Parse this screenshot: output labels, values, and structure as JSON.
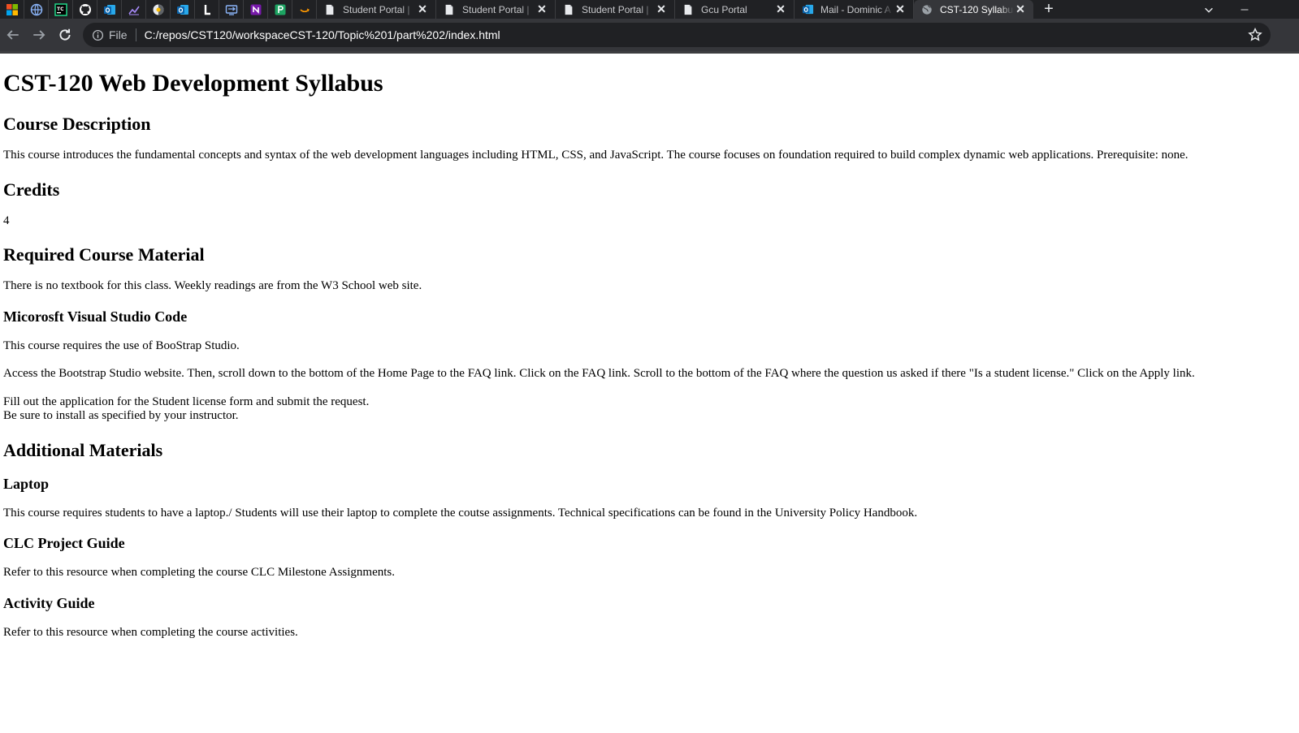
{
  "browser": {
    "tabs": [
      {
        "title": "Student Portal |",
        "icon": "document-icon"
      },
      {
        "title": "Student Portal |",
        "icon": "document-icon"
      },
      {
        "title": "Student Portal |",
        "icon": "document-icon"
      },
      {
        "title": "Gcu Portal",
        "icon": "document-icon"
      },
      {
        "title": "Mail - Dominic A",
        "icon": "outlook-icon"
      },
      {
        "title": "CST-120 Syllabu",
        "icon": "globe-icon"
      }
    ],
    "new_tab_label": "+",
    "close_glyph": "✕",
    "omnibox": {
      "scheme_label": "File",
      "url": "C:/repos/CST120/workspaceCST-120/Topic%201/part%202/index.html"
    },
    "colors": {
      "chrome_dark": "#202124",
      "chrome_mid": "#35363a",
      "tab_text": "#c8c9cc"
    }
  },
  "page": {
    "title": "CST-120 Web Development Syllabus",
    "course_description": {
      "heading": "Course Description",
      "text": "This course introduces the fundamental concepts and syntax of the web development languages including HTML, CSS, and JavaScript. The course focuses on foundation required to build complex dynamic web applications. Prerequisite: none."
    },
    "credits": {
      "heading": "Credits",
      "value": "4"
    },
    "required_material": {
      "heading": "Required Course Material",
      "text": "There is no textbook for this class. Weekly readings are from the W3 School web site.",
      "vscode": {
        "heading": "Micorosft Visual Studio Code",
        "text1": "This course requires the use of BooStrap Studio.",
        "text2": "Access the Bootstrap Studio website. Then, scroll down to the bottom of the Home Page to the FAQ link. Click on the FAQ link. Scroll to the bottom of the FAQ where the question us asked if there \"Is a student license.\" Click on the Apply link.",
        "text3a": "Fill out the application for the Student license form and submit the request.",
        "text3b": "Be sure to install as specified by your instructor."
      }
    },
    "additional_materials": {
      "heading": "Additional Materials",
      "laptop": {
        "heading": "Laptop",
        "text": "This course requires students to have a laptop./ Students will use their laptop to complete the coutse assignments. Technical specifications can be found in the University Policy Handbook."
      },
      "clc": {
        "heading": "CLC Project Guide",
        "text": "Refer to this resource when completing the course CLC Milestone Assignments."
      },
      "activity": {
        "heading": "Activity Guide",
        "text": "Refer to this resource when completing the course activities."
      }
    }
  }
}
